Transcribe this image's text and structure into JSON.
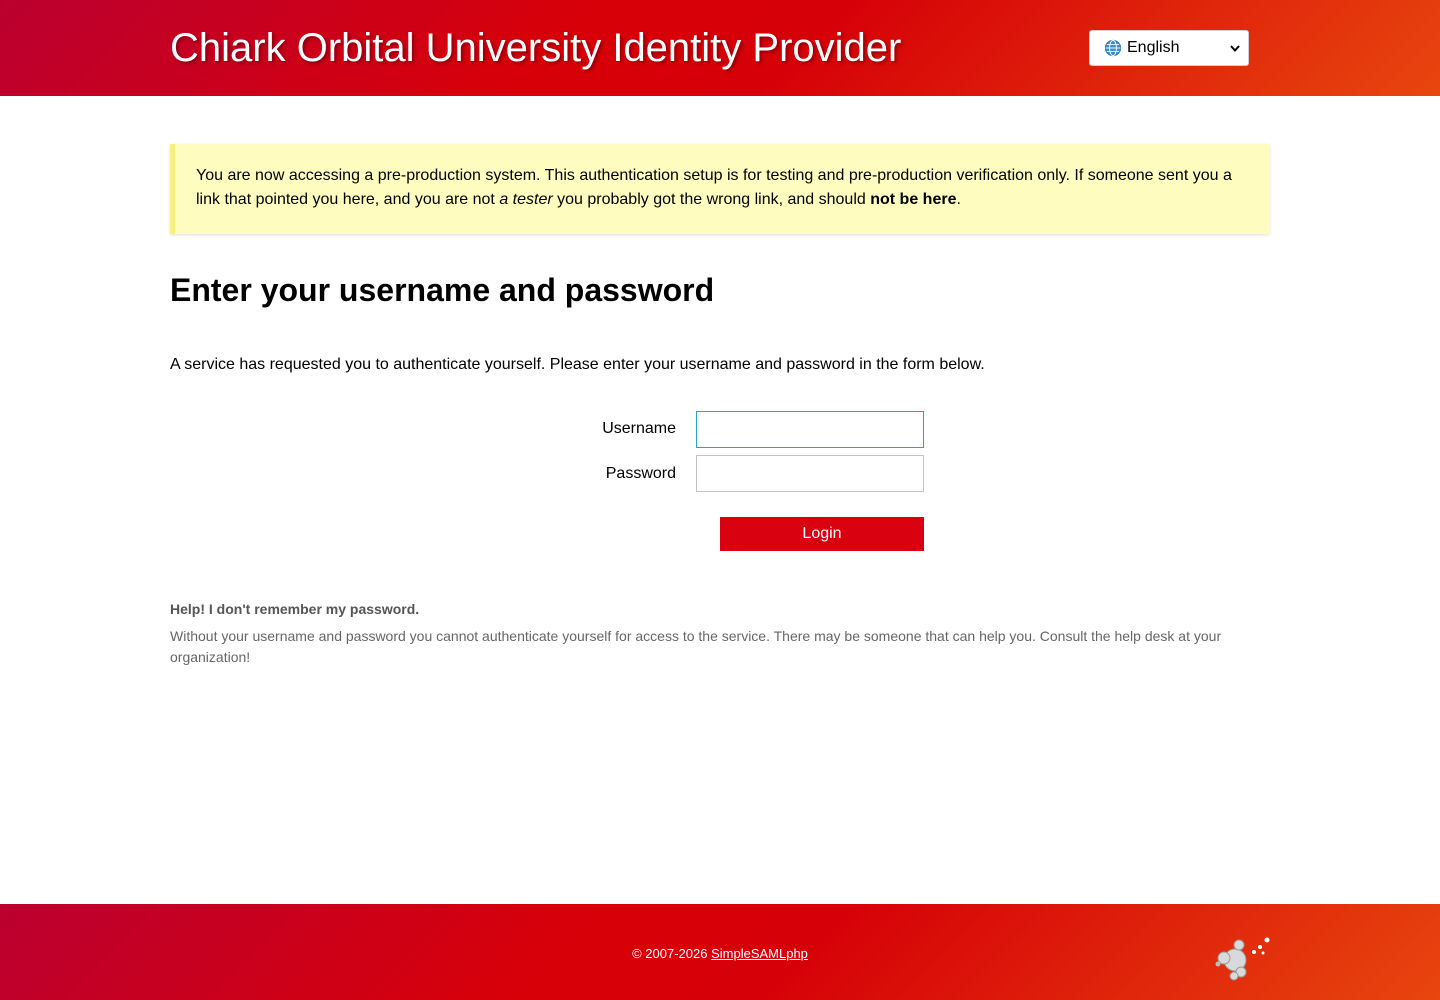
{
  "header": {
    "title": "Chiark Orbital University Identity Provider",
    "language": {
      "selected": "English",
      "icon": "globe-icon"
    }
  },
  "banner": {
    "text_1": "You are now accessing a pre-production system. This authentication setup is for testing and pre-production verification only. If someone sent you a link that pointed you here, and you are not ",
    "emphasis": "a tester",
    "text_2": " you probably got the wrong link, and should ",
    "strong": "not be here",
    "text_3": "."
  },
  "main": {
    "title": "Enter your username and password",
    "intro": "A service has requested you to authenticate yourself. Please enter your username and password in the form below."
  },
  "form": {
    "username_label": "Username",
    "username_value": "",
    "password_label": "Password",
    "password_value": "",
    "login_label": "Login"
  },
  "help": {
    "title": "Help! I don't remember my password.",
    "text": "Without your username and password you cannot authenticate yourself for access to the service. There may be someone that can help you. Consult the help desk at your organization!"
  },
  "footer": {
    "copyright_prefix": "© 2007-2026 ",
    "link_label": "SimpleSAMLphp",
    "logo_icon": "simplesamlphp-logo-icon"
  },
  "colors": {
    "accent": "#d90010",
    "banner_bg": "#fefdbf",
    "banner_border": "#f7f080",
    "focus_border": "#2aa2c8"
  }
}
